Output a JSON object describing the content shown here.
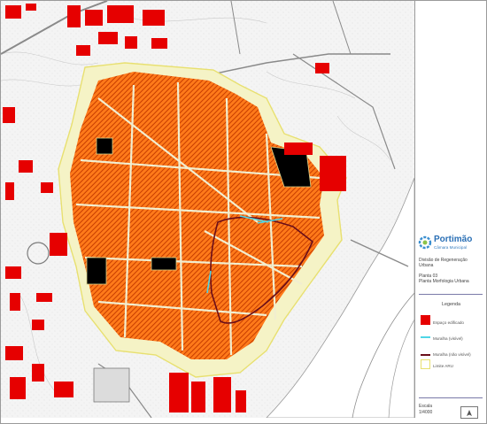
{
  "colors": {
    "built_space": "#e60000",
    "hatch_base": "#ff7a1a",
    "hatch_line": "#c63d00",
    "aru_fill": "#f5f3c6",
    "aru_border": "#e8e070",
    "wall_visible": "#4fd6e6",
    "wall_not_visible": "#6a0f1a",
    "river": "#ffffff",
    "terrain": "#f4f4f4"
  },
  "sidebar": {
    "logo": {
      "title": "Portimão",
      "subtitle": "Câmara Municipal"
    },
    "division": "Divisão de Regeneração\nUrbana",
    "plan": "Planta 03\nPlanta Morfologia Urbana",
    "legend_title": "Legenda",
    "legend": [
      {
        "key": "built",
        "label": "Espaço edificado",
        "icon": "filled-red-square"
      },
      {
        "key": "wall_visible",
        "label": "Muralha (visível)",
        "icon": "cyan-line"
      },
      {
        "key": "wall_not_visible",
        "label": "Muralha (não visível)",
        "icon": "dark-red-line"
      },
      {
        "key": "aru_limit",
        "label": "Limite ARU",
        "icon": "yellow-outline-square"
      }
    ],
    "scale_label": "Escala",
    "scale_value": "1/4000",
    "north_icon": "north-arrow-icon"
  },
  "map": {
    "icons": [
      "river-icon",
      "aru-boundary-icon",
      "city-wall-icon"
    ]
  }
}
